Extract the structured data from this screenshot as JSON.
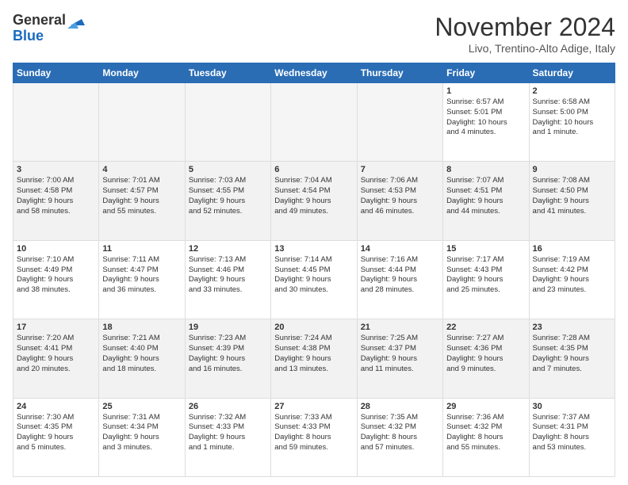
{
  "header": {
    "logo_general": "General",
    "logo_blue": "Blue",
    "month_title": "November 2024",
    "subtitle": "Livo, Trentino-Alto Adige, Italy"
  },
  "weekdays": [
    "Sunday",
    "Monday",
    "Tuesday",
    "Wednesday",
    "Thursday",
    "Friday",
    "Saturday"
  ],
  "weeks": [
    [
      {
        "day": "",
        "info": ""
      },
      {
        "day": "",
        "info": ""
      },
      {
        "day": "",
        "info": ""
      },
      {
        "day": "",
        "info": ""
      },
      {
        "day": "",
        "info": ""
      },
      {
        "day": "1",
        "info": "Sunrise: 6:57 AM\nSunset: 5:01 PM\nDaylight: 10 hours\nand 4 minutes."
      },
      {
        "day": "2",
        "info": "Sunrise: 6:58 AM\nSunset: 5:00 PM\nDaylight: 10 hours\nand 1 minute."
      }
    ],
    [
      {
        "day": "3",
        "info": "Sunrise: 7:00 AM\nSunset: 4:58 PM\nDaylight: 9 hours\nand 58 minutes."
      },
      {
        "day": "4",
        "info": "Sunrise: 7:01 AM\nSunset: 4:57 PM\nDaylight: 9 hours\nand 55 minutes."
      },
      {
        "day": "5",
        "info": "Sunrise: 7:03 AM\nSunset: 4:55 PM\nDaylight: 9 hours\nand 52 minutes."
      },
      {
        "day": "6",
        "info": "Sunrise: 7:04 AM\nSunset: 4:54 PM\nDaylight: 9 hours\nand 49 minutes."
      },
      {
        "day": "7",
        "info": "Sunrise: 7:06 AM\nSunset: 4:53 PM\nDaylight: 9 hours\nand 46 minutes."
      },
      {
        "day": "8",
        "info": "Sunrise: 7:07 AM\nSunset: 4:51 PM\nDaylight: 9 hours\nand 44 minutes."
      },
      {
        "day": "9",
        "info": "Sunrise: 7:08 AM\nSunset: 4:50 PM\nDaylight: 9 hours\nand 41 minutes."
      }
    ],
    [
      {
        "day": "10",
        "info": "Sunrise: 7:10 AM\nSunset: 4:49 PM\nDaylight: 9 hours\nand 38 minutes."
      },
      {
        "day": "11",
        "info": "Sunrise: 7:11 AM\nSunset: 4:47 PM\nDaylight: 9 hours\nand 36 minutes."
      },
      {
        "day": "12",
        "info": "Sunrise: 7:13 AM\nSunset: 4:46 PM\nDaylight: 9 hours\nand 33 minutes."
      },
      {
        "day": "13",
        "info": "Sunrise: 7:14 AM\nSunset: 4:45 PM\nDaylight: 9 hours\nand 30 minutes."
      },
      {
        "day": "14",
        "info": "Sunrise: 7:16 AM\nSunset: 4:44 PM\nDaylight: 9 hours\nand 28 minutes."
      },
      {
        "day": "15",
        "info": "Sunrise: 7:17 AM\nSunset: 4:43 PM\nDaylight: 9 hours\nand 25 minutes."
      },
      {
        "day": "16",
        "info": "Sunrise: 7:19 AM\nSunset: 4:42 PM\nDaylight: 9 hours\nand 23 minutes."
      }
    ],
    [
      {
        "day": "17",
        "info": "Sunrise: 7:20 AM\nSunset: 4:41 PM\nDaylight: 9 hours\nand 20 minutes."
      },
      {
        "day": "18",
        "info": "Sunrise: 7:21 AM\nSunset: 4:40 PM\nDaylight: 9 hours\nand 18 minutes."
      },
      {
        "day": "19",
        "info": "Sunrise: 7:23 AM\nSunset: 4:39 PM\nDaylight: 9 hours\nand 16 minutes."
      },
      {
        "day": "20",
        "info": "Sunrise: 7:24 AM\nSunset: 4:38 PM\nDaylight: 9 hours\nand 13 minutes."
      },
      {
        "day": "21",
        "info": "Sunrise: 7:25 AM\nSunset: 4:37 PM\nDaylight: 9 hours\nand 11 minutes."
      },
      {
        "day": "22",
        "info": "Sunrise: 7:27 AM\nSunset: 4:36 PM\nDaylight: 9 hours\nand 9 minutes."
      },
      {
        "day": "23",
        "info": "Sunrise: 7:28 AM\nSunset: 4:35 PM\nDaylight: 9 hours\nand 7 minutes."
      }
    ],
    [
      {
        "day": "24",
        "info": "Sunrise: 7:30 AM\nSunset: 4:35 PM\nDaylight: 9 hours\nand 5 minutes."
      },
      {
        "day": "25",
        "info": "Sunrise: 7:31 AM\nSunset: 4:34 PM\nDaylight: 9 hours\nand 3 minutes."
      },
      {
        "day": "26",
        "info": "Sunrise: 7:32 AM\nSunset: 4:33 PM\nDaylight: 9 hours\nand 1 minute."
      },
      {
        "day": "27",
        "info": "Sunrise: 7:33 AM\nSunset: 4:33 PM\nDaylight: 8 hours\nand 59 minutes."
      },
      {
        "day": "28",
        "info": "Sunrise: 7:35 AM\nSunset: 4:32 PM\nDaylight: 8 hours\nand 57 minutes."
      },
      {
        "day": "29",
        "info": "Sunrise: 7:36 AM\nSunset: 4:32 PM\nDaylight: 8 hours\nand 55 minutes."
      },
      {
        "day": "30",
        "info": "Sunrise: 7:37 AM\nSunset: 4:31 PM\nDaylight: 8 hours\nand 53 minutes."
      }
    ]
  ]
}
